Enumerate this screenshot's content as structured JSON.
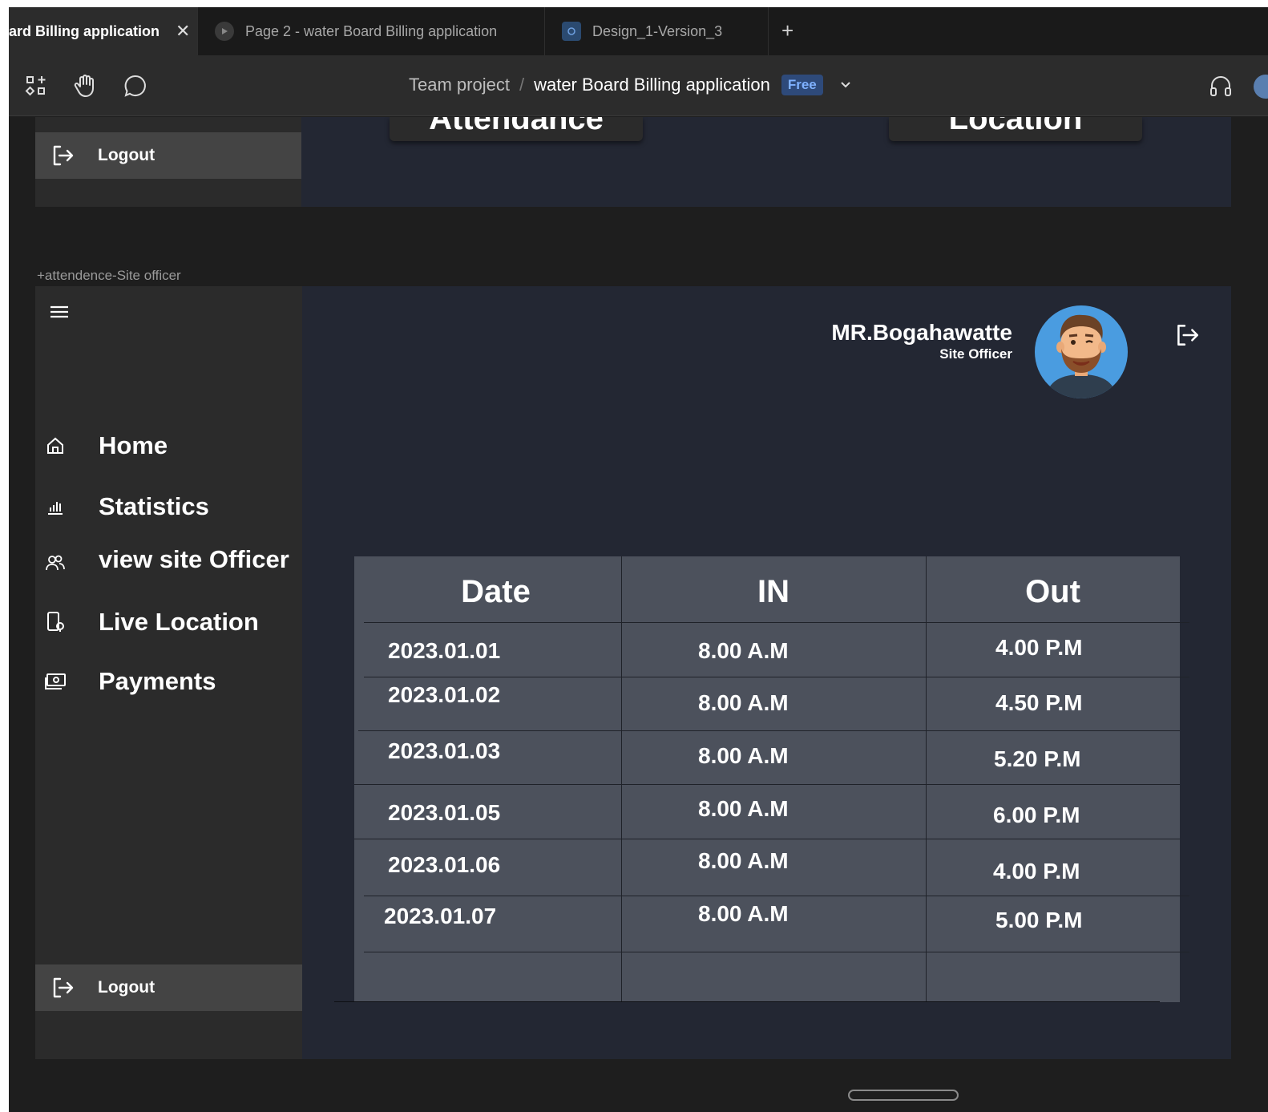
{
  "tabs": [
    {
      "label": "ard Billing application",
      "active": true
    },
    {
      "label": "Page 2 - water Board Billing application",
      "active": false
    },
    {
      "label": "Design_1-Version_3",
      "active": false
    }
  ],
  "toolbar": {
    "team": "Team project",
    "separator": "/",
    "file_name": "water Board Billing application",
    "plan_badge": "Free",
    "icons": [
      "frames-icon",
      "hand-icon",
      "comment-icon",
      "headphones-icon"
    ]
  },
  "top_frame": {
    "partial_buttons": [
      "Attendance",
      "Location"
    ],
    "logout_label": "Logout"
  },
  "frame_label": "+attendence-Site officer",
  "main_frame": {
    "user": {
      "name": "MR.Bogahawatte",
      "role": "Site Officer"
    },
    "nav": [
      {
        "label": "Home",
        "icon": "home-icon"
      },
      {
        "label": "Statistics",
        "icon": "bar-chart-icon"
      },
      {
        "label": "view site Officer",
        "icon": "users-icon"
      },
      {
        "label": "Live Location",
        "icon": "location-device-icon"
      },
      {
        "label": "Payments",
        "icon": "money-icon"
      }
    ],
    "logout_label": "Logout",
    "table": {
      "headers": [
        "Date",
        "IN",
        "Out"
      ],
      "rows": [
        [
          "2023.01.01",
          "8.00 A.M",
          "4.00 P.M"
        ],
        [
          "2023.01.02",
          "8.00 A.M",
          "4.50 P.M"
        ],
        [
          "2023.01.03",
          "8.00 A.M",
          "5.20 P.M"
        ],
        [
          "2023.01.05",
          "8.00 A.M",
          "6.00 P.M"
        ],
        [
          "2023.01.06",
          "8.00 A.M",
          "4.00 P.M"
        ],
        [
          "2023.01.07",
          "8.00 A.M",
          "5.00 P.M"
        ]
      ]
    }
  },
  "colors": {
    "canvas": "#1e1e1e",
    "frame_bg": "#232733",
    "sidebar_bg": "#2b2b2b",
    "table_bg": "#4c515c",
    "badge": "#2e4a7a"
  }
}
